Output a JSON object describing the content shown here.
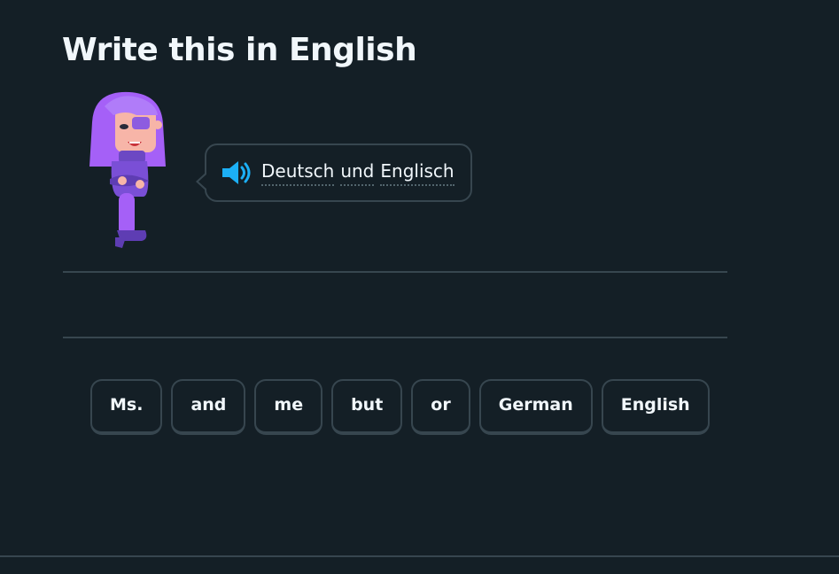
{
  "exercise": {
    "title": "Write this in English"
  },
  "prompt": {
    "speaker_icon": "speaker-icon",
    "words": [
      "Deutsch",
      "und",
      "Englisch"
    ]
  },
  "word_bank": {
    "words": [
      "Ms.",
      "and",
      "me",
      "but",
      "or",
      "German",
      "English"
    ]
  },
  "colors": {
    "background": "#141f26",
    "border": "#37464f",
    "text": "#f1f7fb",
    "speaker_accent": "#1cb0f6",
    "character_hair": "#a560f7",
    "character_body": "#7a4fd6"
  }
}
